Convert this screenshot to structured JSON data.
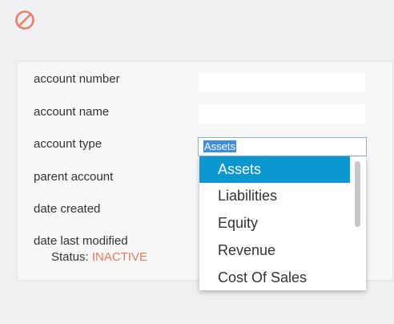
{
  "icons": {
    "status_icon": "ban-icon",
    "status_icon_color": "#f07c6b"
  },
  "form": {
    "labels": {
      "account_number": "account number",
      "account_name": "account name",
      "account_type": "account type",
      "parent_account": "parent account",
      "date_created": "date created",
      "date_last_modified": "date last modified"
    },
    "account_number_value": "",
    "account_name_value": "",
    "account_type_value": "Assets",
    "status_label": "Status:",
    "status_value": "INACTIVE"
  },
  "dropdown": {
    "options": [
      "Assets",
      "Liabilities",
      "Equity",
      "Revenue",
      "Cost Of Sales"
    ],
    "selected": "Assets"
  },
  "colors": {
    "selected_option_bg": "#0b97cf",
    "status_value": "#e07b5a",
    "text_selection_bg": "#3f8ed8"
  }
}
